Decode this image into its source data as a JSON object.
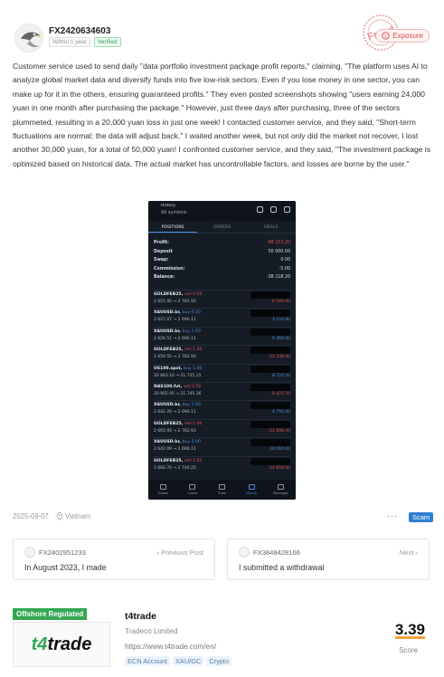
{
  "post": {
    "username": "FX2420634603",
    "badge_age": "Within 1 year",
    "badge_verified": "Verified",
    "exposure_label": "Exposure",
    "stamp_text": "Fraud",
    "body": "Customer service used to send daily \"data portfolio investment package profit reports,\" claiming, \"The platform uses AI to analyze global market data and diversify funds into five low-risk sectors. Even if you lose money in one sector, you can make up for it in the others, ensuring guaranteed profits.\" They even posted screenshots showing \"users earning 24,000 yuan in one month after purchasing the package.\" However, just three days after purchasing, three of the sectors plummeted, resulting in a 20,000 yuan loss in just one week! I contacted customer service, and they said, \"Short-term fluctuations are normal; the data will adjust back.\" I waited another week, but not only did the market not recover, I lost another 30,000 yuan, for a total of 50,000 yuan! I confronted customer service, and they said, \"The investment package is optimized based on historical data. The actual market has uncontrollable factors, and losses are borne by the user.\"",
    "date": "2025-09-07",
    "location": "Vietnam",
    "more": "···",
    "tag": "Scam"
  },
  "screenshot": {
    "title_line1": "History",
    "title_line2": "All symbols",
    "tabs": [
      "POSITIONS",
      "ORDERS",
      "DEALS"
    ],
    "account": [
      {
        "k": "Profit:",
        "v": "-68 213.20",
        "red": true
      },
      {
        "k": "Deposit",
        "v": "50 000.00",
        "red": false
      },
      {
        "k": "Swap:",
        "v": "0.00",
        "red": false
      },
      {
        "k": "Commission:",
        "v": "-5.00",
        "red": false
      },
      {
        "k": "Balance:",
        "v": "-38 218.20",
        "red": false
      }
    ],
    "positions": [
      {
        "symbol": "GOLDFEB25,",
        "side": "sell 0.50",
        "dir": "sell",
        "prices": "2 651.95 → 2 782.93",
        "pl": "-6 549.00",
        "plc": "red"
      },
      {
        "symbol": "XAUUSD.br,",
        "side": "buy 0.50",
        "dir": "buy",
        "prices": "2 627.07 → 2 690.11",
        "pl": "3 152.00",
        "plc": "blue"
      },
      {
        "symbol": "XAUUSD.br,",
        "side": "buy 1.00",
        "dir": "buy",
        "prices": "2 626.51 → 2 690.11",
        "pl": "6 360.00",
        "plc": "blue"
      },
      {
        "symbol": "GOLDFEB25,",
        "side": "sell 1.00",
        "dir": "sell",
        "prices": "2 659.55 → 2 782.93",
        "pl": "-12 338.00",
        "plc": "red"
      },
      {
        "symbol": "US100.spot,",
        "side": "buy 1.00",
        "dir": "buy",
        "prices": "20 863.10 → 21 735.15",
        "pl": "8 720.50",
        "plc": "blue"
      },
      {
        "symbol": "NAS100.fut,",
        "side": "sell 0.50",
        "dir": "sell",
        "prices": "20 902.95 → 21 745.36",
        "pl": "-8 423.70",
        "plc": "red"
      },
      {
        "symbol": "XAUUSD.br,",
        "side": "buy 1.00",
        "dir": "buy",
        "prices": "2 642.20 → 2 690.11",
        "pl": "4 791.00",
        "plc": "blue"
      },
      {
        "symbol": "GOLDFEB25,",
        "side": "sell 1.00",
        "dir": "sell",
        "prices": "2 665.95 → 2 782.93",
        "pl": "-11 698.00",
        "plc": "red"
      },
      {
        "symbol": "XAUUSD.br,",
        "side": "buy 5.00",
        "dir": "buy",
        "prices": "2 642.09 → 2 690.11",
        "pl": "24 010.00",
        "plc": "blue"
      },
      {
        "symbol": "GOLDFEB25,",
        "side": "sell 2.02",
        "dir": "sell",
        "prices": "2 666.70 → 2 740.25",
        "pl": "-14 858.00",
        "plc": "red"
      }
    ],
    "nav": [
      "Quotes",
      "Charts",
      "Trade",
      "History",
      "Messages"
    ]
  },
  "prev": {
    "user": "FX2402951233",
    "label": "‹ Previous Post",
    "title": "In August 2023, I made"
  },
  "next": {
    "user": "FX3848428166",
    "label": "Next ›",
    "title": "I submitted a withdrawal"
  },
  "broker": {
    "regulation": "Offshore Regulated",
    "logo_a": "t4",
    "logo_b": "trade",
    "name": "t4trade",
    "company": "Tradeco Limited",
    "url": "https://www.t4trade.com/en/",
    "tags": [
      "ECN Account",
      "XAU/GC",
      "Crypto"
    ],
    "score": "3.39",
    "score_label": "Score"
  }
}
